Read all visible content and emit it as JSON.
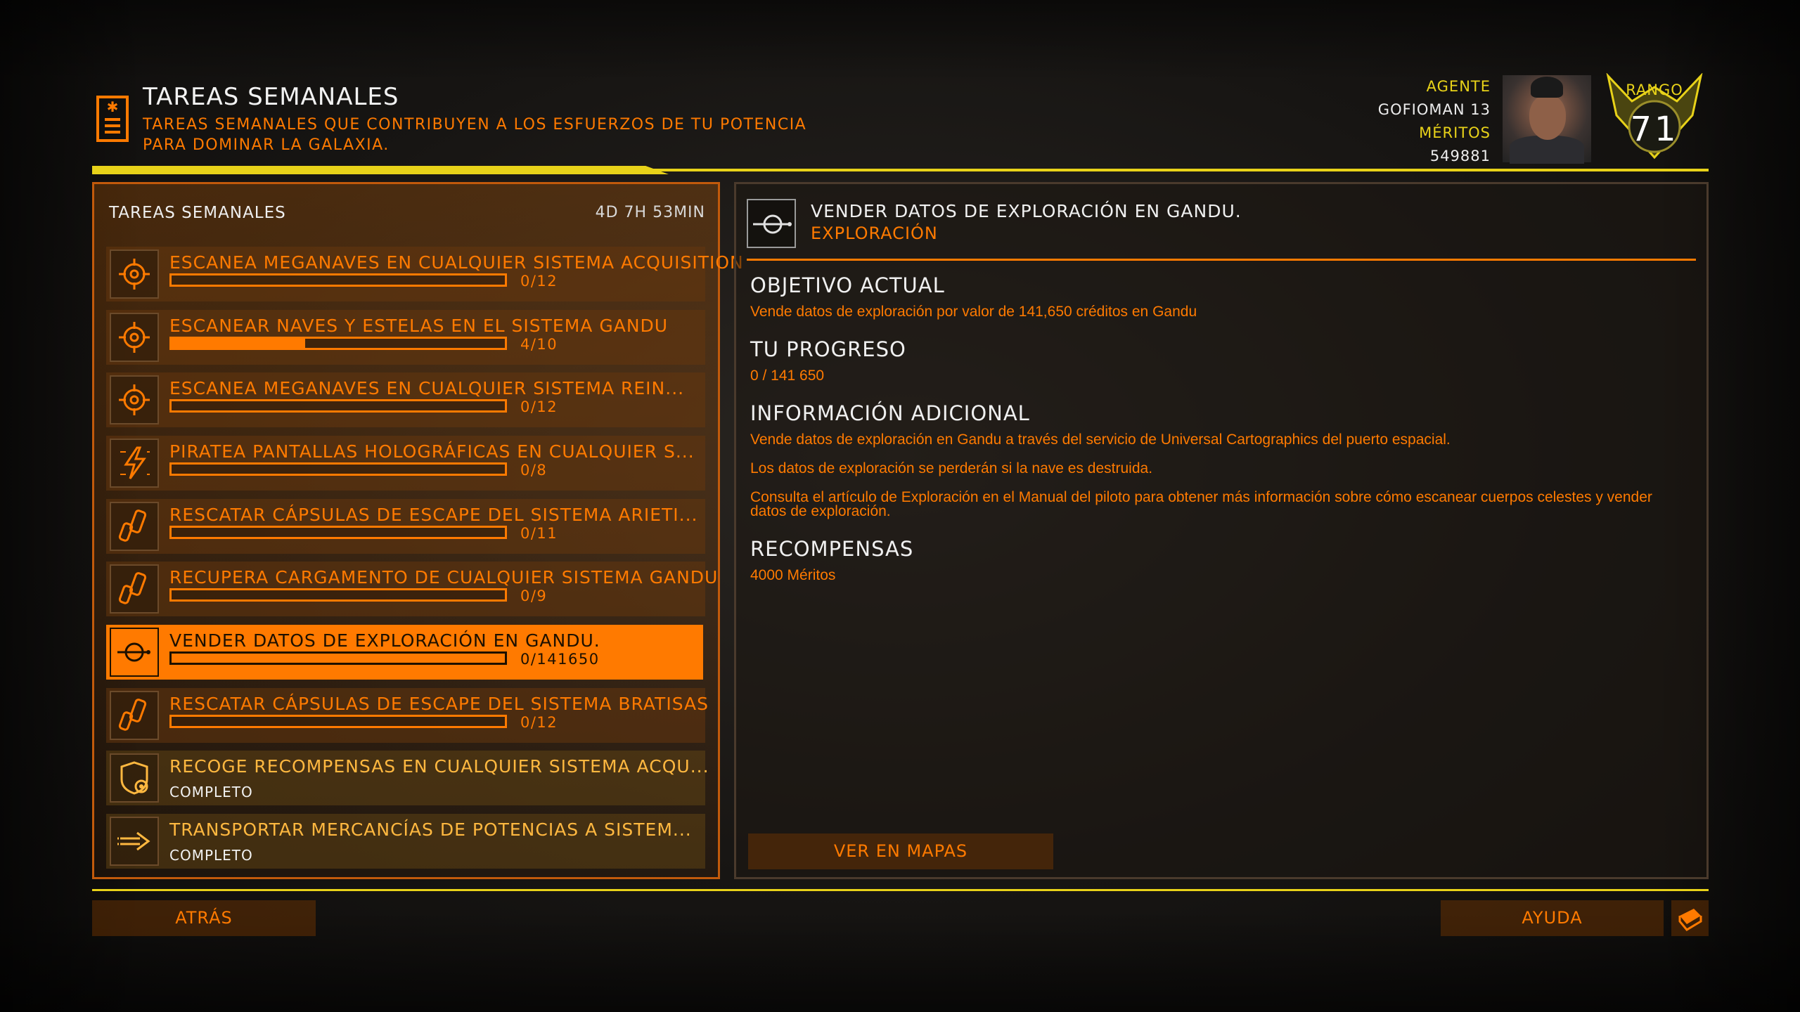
{
  "header": {
    "title": "TAREAS SEMANALES",
    "subtitle": "TAREAS SEMANALES QUE CONTRIBUYEN A LOS ESFUERZOS DE TU POTENCIA PARA DOMINAR LA GALAXIA.",
    "icon": "task-list-icon"
  },
  "agent": {
    "agent_label": "AGENTE",
    "agent_name": "GOFIOMAN 13",
    "merits_label": "MÉRITOS",
    "merits_value": "549881",
    "rank_label": "RANGO",
    "rank_value": "71"
  },
  "tasks_panel": {
    "title": "TAREAS SEMANALES",
    "time_left": "4D 7H 53MIN",
    "tasks": [
      {
        "icon": "scan-target-icon",
        "name": "ESCANEA MEGANAVES EN CUALQUIER SISTEMA ACQUISITION",
        "count": "0/12",
        "progress": 0
      },
      {
        "icon": "scan-target-icon",
        "name": "ESCANEAR NAVES Y ESTELAS EN EL SISTEMA GANDU",
        "count": "4/10",
        "progress": 0.4
      },
      {
        "icon": "scan-target-icon",
        "name": "ESCANEA MEGANAVES EN CUALQUIER SISTEMA REIN...",
        "count": "0/12",
        "progress": 0
      },
      {
        "icon": "hack-lightning-icon",
        "name": "PIRATEA PANTALLAS HOLOGRÁFICAS EN CUALQUIER S...",
        "count": "0/8",
        "progress": 0
      },
      {
        "icon": "canister-icon",
        "name": "RESCATAR CÁPSULAS DE ESCAPE DEL SISTEMA ARIETI...",
        "count": "0/11",
        "progress": 0
      },
      {
        "icon": "canister-icon",
        "name": "RECUPERA CARGAMENTO DE CUALQUIER SISTEMA GANDU",
        "count": "0/9",
        "progress": 0
      },
      {
        "icon": "exploration-probe-icon",
        "name": "VENDER DATOS DE EXPLORACIÓN EN GANDU.",
        "count": "0/141650",
        "progress": 0
      },
      {
        "icon": "canister-icon",
        "name": "RESCATAR CÁPSULAS DE ESCAPE DEL SISTEMA BRATISAS",
        "count": "0/12",
        "progress": 0
      },
      {
        "icon": "bounty-gear-icon",
        "name": "RECOGE RECOMPENSAS EN CUALQUIER SISTEMA ACQU...",
        "status": "COMPLETO"
      },
      {
        "icon": "transport-arrow-icon",
        "name": "TRANSPORTAR MERCANCÍAS DE POTENCIAS A SISTEM...",
        "status": "COMPLETO"
      }
    ]
  },
  "detail": {
    "icon": "exploration-probe-icon",
    "title": "VENDER DATOS DE EXPLORACIÓN EN GANDU.",
    "type": "EXPLORACIÓN",
    "objective_h": "OBJETIVO ACTUAL",
    "objective_t": "Vende datos de exploración por valor de 141,650 créditos en Gandu",
    "progress_h": "TU PROGRESO",
    "progress_t": "0 / 141 650",
    "info_h": "INFORMACIÓN ADICIONAL",
    "info_1": "Vende datos de exploración en Gandu a través del servicio de Universal Cartographics del puerto espacial.",
    "info_2": "Los datos de exploración se perderán si la nave es destruida.",
    "info_3": "Consulta el artículo de Exploración en el Manual del piloto para obtener más información sobre cómo escanear cuerpos celestes y vender datos de exploración.",
    "rewards_h": "RECOMPENSAS",
    "rewards_t": "4000 Méritos",
    "map_button": "VER EN MAPAS"
  },
  "footer": {
    "back": "ATRÁS",
    "help": "AYUDA",
    "help_icon": "manual-book-icon"
  },
  "colors": {
    "accent": "#ff7a00",
    "yellow": "#e8d219",
    "complete": "#ffb840"
  }
}
